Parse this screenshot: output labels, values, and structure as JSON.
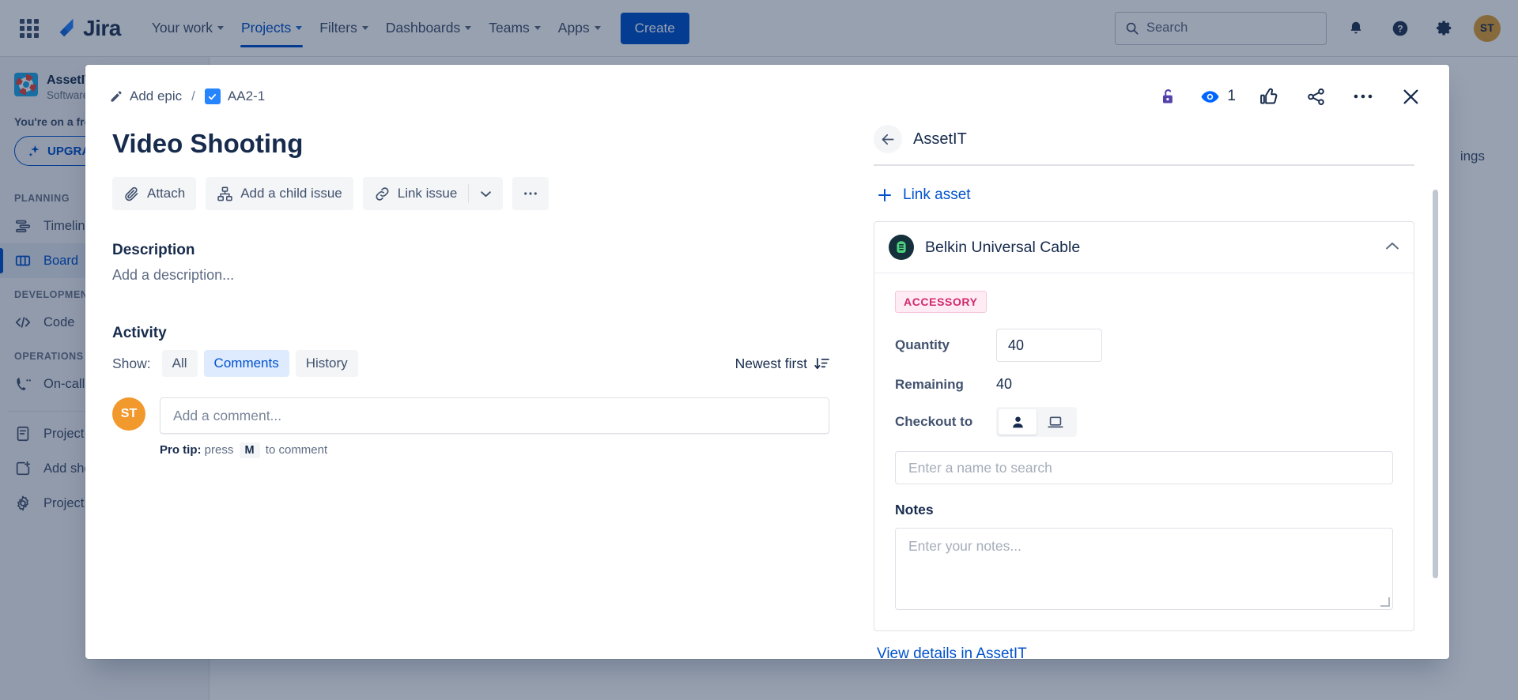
{
  "topnav": {
    "apps_icon": "apps-grid-icon",
    "brand": "Jira",
    "items": [
      {
        "label": "Your work",
        "has_dropdown": true,
        "active": false
      },
      {
        "label": "Projects",
        "has_dropdown": true,
        "active": true
      },
      {
        "label": "Filters",
        "has_dropdown": true,
        "active": false
      },
      {
        "label": "Dashboards",
        "has_dropdown": true,
        "active": false
      },
      {
        "label": "Teams",
        "has_dropdown": true,
        "active": false
      },
      {
        "label": "Apps",
        "has_dropdown": true,
        "active": false
      }
    ],
    "create_label": "Create",
    "search_placeholder": "Search",
    "icons": [
      "notifications-bell-icon",
      "help-icon",
      "settings-gear-icon"
    ],
    "avatar_initials": "ST"
  },
  "sidebar": {
    "project_name": "AssetIT Demo",
    "project_type": "Software project",
    "trial_text": "You're on a free trial",
    "upgrade_label": "UPGRADE",
    "sections": [
      {
        "label": "PLANNING",
        "items": [
          {
            "label": "Timeline",
            "icon": "timeline-icon",
            "selected": false
          },
          {
            "label": "Board",
            "icon": "board-icon",
            "selected": true
          }
        ]
      },
      {
        "label": "DEVELOPMENT",
        "items": [
          {
            "label": "Code",
            "icon": "code-icon",
            "selected": false
          }
        ]
      },
      {
        "label": "OPERATIONS",
        "items": [
          {
            "label": "On-call",
            "icon": "oncall-icon",
            "selected": false
          }
        ]
      }
    ],
    "footer_items": [
      {
        "label": "Project pages",
        "icon": "pages-icon"
      },
      {
        "label": "Add shortcut",
        "icon": "add-shortcut-icon"
      },
      {
        "label": "Project settings",
        "icon": "settings-gear-icon"
      }
    ]
  },
  "board": {
    "more_label": "•••",
    "settings_label": "ings"
  },
  "modal": {
    "breadcrumb": {
      "epic_label": "Add epic",
      "separator": "/",
      "issue_key": "AA2-1"
    },
    "header_actions": {
      "lock_icon": "unlock-icon",
      "watch_count": "1",
      "like_icon": "thumbs-up-icon",
      "share_icon": "share-icon",
      "more_icon": "more-actions-icon",
      "close_icon": "close-icon"
    },
    "issue_title": "Video Shooting",
    "buttons": {
      "attach": "Attach",
      "add_child": "Add a child issue",
      "link_issue": "Link issue",
      "more": "•••"
    },
    "description": {
      "heading": "Description",
      "placeholder": "Add a description..."
    },
    "activity": {
      "heading": "Activity",
      "show_label": "Show:",
      "tabs": [
        {
          "label": "All",
          "selected": false
        },
        {
          "label": "Comments",
          "selected": true
        },
        {
          "label": "History",
          "selected": false
        }
      ],
      "sort_label": "Newest first",
      "avatar_initials": "ST",
      "comment_placeholder": "Add a comment...",
      "protip_prefix": "Pro tip:",
      "protip_press": "press",
      "protip_key": "M",
      "protip_suffix": "to comment"
    }
  },
  "assetit": {
    "panel_title": "AssetIT",
    "back_icon": "back-arrow-icon",
    "link_asset_label": "Link asset",
    "asset": {
      "name": "Belkin Universal Cable",
      "icon": "asset-cable-icon",
      "collapse_icon": "chevron-up-icon",
      "badge": "ACCESSORY",
      "quantity_label": "Quantity",
      "quantity_value": "40",
      "remaining_label": "Remaining",
      "remaining_value": "40",
      "checkout_label": "Checkout to",
      "checkout_options": [
        {
          "icon": "person-icon",
          "selected": true
        },
        {
          "icon": "laptop-icon",
          "selected": false
        }
      ],
      "name_search_placeholder": "Enter a name to search",
      "notes_label": "Notes",
      "notes_placeholder": "Enter your notes...",
      "view_details_label": "View details in AssetIT"
    }
  },
  "colors": {
    "brand_blue": "#0052CC",
    "link_blue": "#0052CC",
    "badge_pink_bg": "#FFEBF3",
    "badge_pink_text": "#CF2A6E",
    "avatar_orange": "#F2992E",
    "lock_purple": "#5243AA"
  }
}
